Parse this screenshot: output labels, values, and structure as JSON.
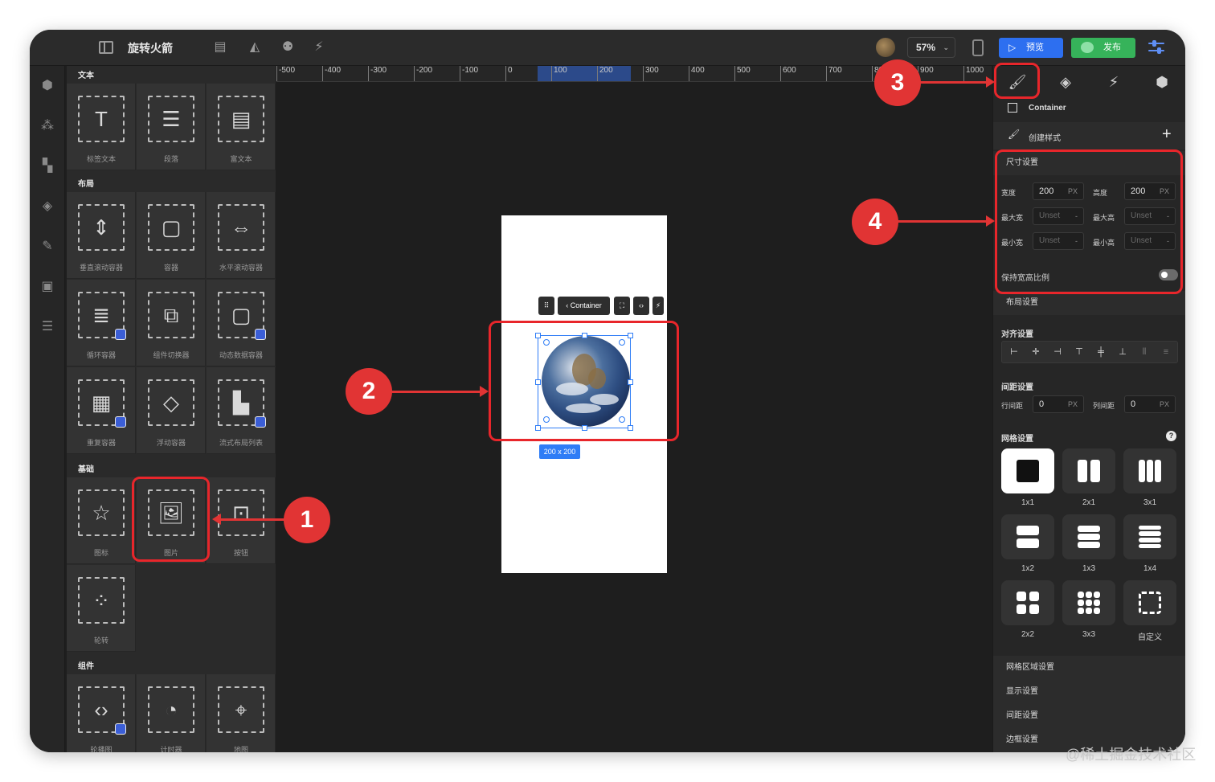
{
  "app": {
    "title": "旋转火箭",
    "zoom": "57%",
    "preview_label": "预览",
    "publish_label": "发布"
  },
  "panel": {
    "sections": [
      {
        "title": "文本",
        "items": [
          {
            "label": "标签文本",
            "icon": "text-label-icon"
          },
          {
            "label": "段落",
            "icon": "paragraph-icon"
          },
          {
            "label": "富文本",
            "icon": "rich-text-icon"
          }
        ]
      },
      {
        "title": "布局",
        "items": [
          {
            "label": "垂直滚动容器",
            "icon": "vertical-scroll-icon"
          },
          {
            "label": "容器",
            "icon": "container-icon"
          },
          {
            "label": "水平滚动容器",
            "icon": "horizontal-scroll-icon"
          },
          {
            "label": "循环容器",
            "icon": "loop-container-icon"
          },
          {
            "label": "组件切换器",
            "icon": "component-switcher-icon"
          },
          {
            "label": "动态数据容器",
            "icon": "dynamic-data-icon"
          },
          {
            "label": "重复容器",
            "icon": "repeat-container-icon"
          },
          {
            "label": "浮动容器",
            "icon": "float-container-icon"
          },
          {
            "label": "流式布局列表",
            "icon": "flow-layout-icon"
          }
        ]
      },
      {
        "title": "基础",
        "items": [
          {
            "label": "图标",
            "icon": "star-icon"
          },
          {
            "label": "图片",
            "icon": "image-icon"
          },
          {
            "label": "按钮",
            "icon": "button-icon"
          },
          {
            "label": "轮转",
            "icon": "spinner-icon"
          }
        ]
      },
      {
        "title": "组件",
        "items": [
          {
            "label": "轮播图",
            "icon": "carousel-icon"
          },
          {
            "label": "计时器",
            "icon": "timer-icon"
          },
          {
            "label": "地图",
            "icon": "map-pin-icon"
          }
        ]
      }
    ]
  },
  "ruler": {
    "ticks": [
      "-500",
      "-400",
      "-300",
      "-200",
      "-100",
      "0",
      "100",
      "200",
      "300",
      "400",
      "500",
      "600",
      "700",
      "800",
      "900",
      "1000"
    ]
  },
  "canvas": {
    "toolbar_label": "Container",
    "size_badge": "200 x 200"
  },
  "inspector": {
    "element_name": "Container",
    "create_style": "创建样式",
    "size_section": {
      "title": "尺寸设置",
      "width_label": "宽度",
      "width_value": "200",
      "height_label": "高度",
      "height_value": "200",
      "unit": "PX",
      "max_width_label": "最大宽",
      "max_height_label": "最大高",
      "min_width_label": "最小宽",
      "min_height_label": "最小高",
      "unset": "Unset",
      "keep_ratio_label": "保持宽高比例"
    },
    "layout_title": "布局设置",
    "align_title": "对齐设置",
    "spacing_title": "间距设置",
    "row_gap_label": "行间距",
    "row_gap_value": "0",
    "col_gap_label": "列间距",
    "col_gap_value": "0",
    "grid_title": "网格设置",
    "grid_options": [
      "1x1",
      "2x1",
      "3x1",
      "1x2",
      "1x3",
      "1x4",
      "2x2",
      "3x3",
      "自定义"
    ],
    "collapsed_sections": [
      "网格区域设置",
      "显示设置",
      "间距设置",
      "边框设置"
    ]
  },
  "annotations": [
    "1",
    "2",
    "3",
    "4"
  ],
  "watermark": "@稀土掘金技术社区",
  "colors": {
    "accent": "#2d6ff0",
    "publish": "#36b35a",
    "annotation": "#e13434",
    "selection": "#2f7df6"
  }
}
